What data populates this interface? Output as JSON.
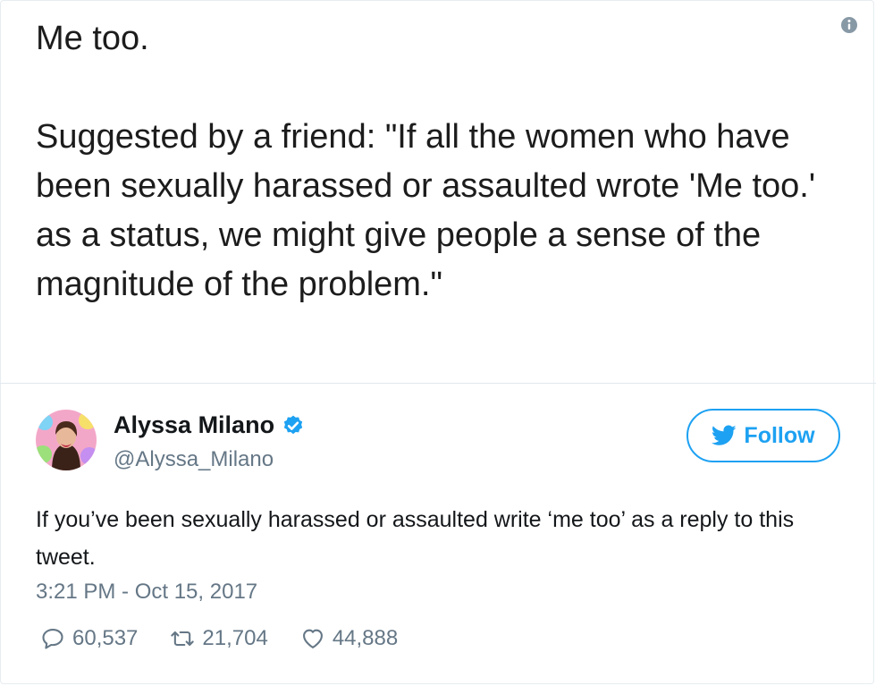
{
  "image_text": {
    "line1": "Me too.",
    "line2": "Suggested by a friend: \"If all the women who have been sexually harassed or assaulted wrote 'Me too.' as a status, we might give people a sense of the magnitude of the problem.\""
  },
  "icons": {
    "info": "info-icon",
    "verified": "verified-badge-icon",
    "follow_bird": "twitter-bird-icon",
    "reply": "reply-icon",
    "retweet": "retweet-icon",
    "like": "heart-icon"
  },
  "author": {
    "display_name": "Alyssa Milano",
    "handle": "@Alyssa_Milano"
  },
  "follow_button": {
    "label": "Follow"
  },
  "tweet": {
    "text": "If you’ve been sexually harassed or assaulted write ‘me too’ as a reply to this tweet.",
    "timestamp": "3:21 PM - Oct 15, 2017"
  },
  "stats": {
    "replies": "60,537",
    "retweets": "21,704",
    "likes": "44,888"
  },
  "colors": {
    "accent": "#1da1f2",
    "secondary_text": "#657786",
    "primary_text": "#14171a"
  }
}
